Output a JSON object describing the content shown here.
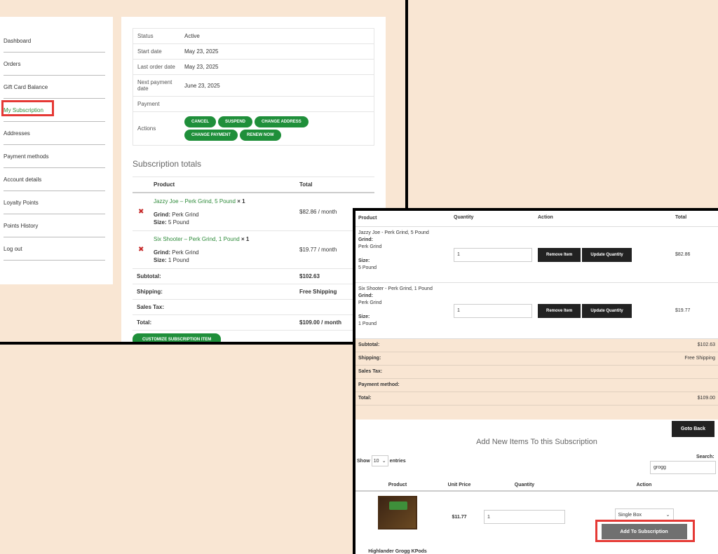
{
  "sidebar": {
    "items": [
      {
        "label": "Dashboard"
      },
      {
        "label": "Orders"
      },
      {
        "label": "Gift Card Balance"
      },
      {
        "label": "My Subscription"
      },
      {
        "label": "Addresses"
      },
      {
        "label": "Payment methods"
      },
      {
        "label": "Account details"
      },
      {
        "label": "Loyalty Points"
      },
      {
        "label": "Points History"
      },
      {
        "label": "Log out"
      }
    ]
  },
  "details": {
    "status_label": "Status",
    "status_value": "Active",
    "start_label": "Start date",
    "start_value": "May 23, 2025",
    "last_order_label": "Last order date",
    "last_order_value": "May 23, 2025",
    "next_payment_label": "Next payment date",
    "next_payment_value": "June 23, 2025",
    "payment_label": "Payment",
    "actions_label": "Actions",
    "actions": [
      "CANCEL",
      "SUSPEND",
      "CHANGE ADDRESS",
      "CHANGE PAYMENT",
      "RENEW NOW"
    ]
  },
  "totals": {
    "heading": "Subscription totals",
    "col_product": "Product",
    "col_total": "Total",
    "items": [
      {
        "name": "Jazzy Joe – Perk Grind, 5 Pound",
        "qty": "× 1",
        "grind_label": "Grind:",
        "grind": "Perk Grind",
        "size_label": "Size:",
        "size": "5 Pound",
        "total": "$82.86 / month"
      },
      {
        "name": "Six Shooter – Perk Grind, 1 Pound",
        "qty": "× 1",
        "grind_label": "Grind:",
        "grind": "Perk Grind",
        "size_label": "Size:",
        "size": "1 Pound",
        "total": "$19.77 / month"
      }
    ],
    "subtotal_label": "Subtotal:",
    "subtotal": "$102.63",
    "shipping_label": "Shipping:",
    "shipping": "Free Shipping",
    "tax_label": "Sales Tax:",
    "total_label": "Total:",
    "total": "$109.00 / month",
    "customize_btn": "CUSTOMIZE SUBSCRIPTION ITEM"
  },
  "edit": {
    "col_product": "Product",
    "col_quantity": "Quantity",
    "col_action": "Action",
    "col_total": "Total",
    "items": [
      {
        "name": "Jazzy Joe - Perk Grind, 5 Pound",
        "grind_label": "Grind:",
        "grind": "Perk Grind",
        "size_label": "Size:",
        "size": "5 Pound",
        "qty": "1",
        "total": "$82.86"
      },
      {
        "name": "Six Shooter - Perk Grind, 1 Pound",
        "grind_label": "Grind:",
        "grind": "Perk Grind",
        "size_label": "Size:",
        "size": "1 Pound",
        "qty": "1",
        "total": "$19.77"
      }
    ],
    "remove_btn": "Remove Item",
    "update_btn": "Update Quantity",
    "subtotal_label": "Subtotal:",
    "subtotal": "$102.63",
    "shipping_label": "Shipping:",
    "shipping": "Free Shipping",
    "tax_label": "Sales Tax:",
    "payment_method_label": "Payment method:",
    "total_label": "Total:",
    "total": "$109.00",
    "goto_back": "Goto Back"
  },
  "add": {
    "heading": "Add New Items To this Subscription",
    "show_label": "Show",
    "show_value": "10",
    "entries_label": "entries",
    "search_label": "Search:",
    "search_value": "grogg",
    "col_product": "Product",
    "col_unit_price": "Unit Price",
    "col_quantity": "Quantity",
    "col_action": "Action",
    "product_name": "Highlander Grogg KPods",
    "unit_price": "$11.77",
    "qty": "1",
    "option": "Single Box",
    "add_btn": "Add To Subscription"
  },
  "colors": {
    "accent_green": "#1f8f3a",
    "highlight_red": "#e53935",
    "background_peach": "#f9e6d3"
  }
}
